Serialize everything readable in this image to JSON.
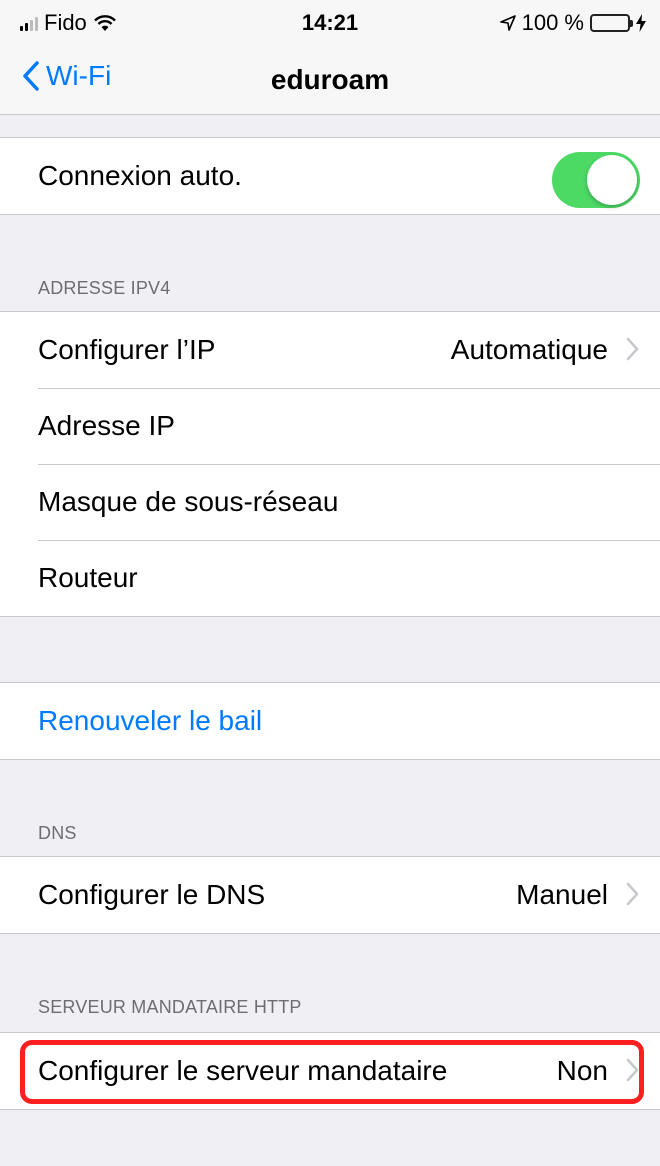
{
  "status_bar": {
    "carrier": "Fido",
    "time": "14:21",
    "battery_percent": "100 %",
    "battery_level": 1.0
  },
  "nav": {
    "back_label": "Wi-Fi",
    "title": "eduroam"
  },
  "auto_join": {
    "label": "Connexion auto.",
    "enabled": true
  },
  "ipv4": {
    "header": "ADRESSE IPV4",
    "configure_ip_label": "Configurer l’IP",
    "configure_ip_value": "Automatique",
    "ip_address_label": "Adresse IP",
    "subnet_label": "Masque de sous-réseau",
    "router_label": "Routeur"
  },
  "lease": {
    "renew_label": "Renouveler le bail"
  },
  "dns": {
    "header": "DNS",
    "configure_dns_label": "Configurer le DNS",
    "configure_dns_value": "Manuel"
  },
  "proxy": {
    "header": "SERVEUR MANDATAIRE HTTP",
    "configure_proxy_label": "Configurer le serveur mandataire",
    "configure_proxy_value": "Non"
  },
  "colors": {
    "accent": "#007aff",
    "toggle_on": "#4cd964",
    "highlight": "#ff1f1f"
  }
}
